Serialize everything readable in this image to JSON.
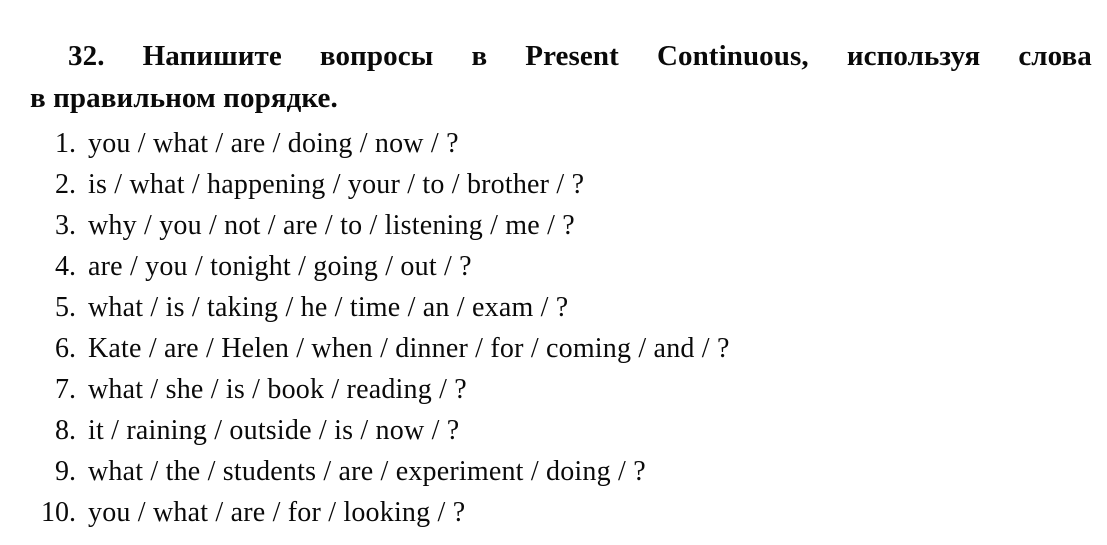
{
  "document": {
    "type": "worksheet-exercise",
    "language_mix": "russian-instruction-english-items",
    "background_color": "#ffffff",
    "text_color": "#0a0a0a"
  },
  "heading": {
    "number": "32.",
    "line_1_words": [
      "32.",
      "Напишите",
      "вопросы",
      "в",
      "Present",
      "Continuous,",
      "используя",
      "слова"
    ],
    "line_2": "в правильном порядке.",
    "full_text": "32. Напишите вопросы в Present Continuous, используя слова в правильном порядке."
  },
  "task_list": {
    "items": [
      {
        "number": "1.",
        "text": "you / what / are / doing / now / ?"
      },
      {
        "number": "2.",
        "text": "is / what / happening / your / to / brother / ?"
      },
      {
        "number": "3.",
        "text": "why / you / not / are / to / listening / me / ?"
      },
      {
        "number": "4.",
        "text": "are / you / tonight / going / out / ?"
      },
      {
        "number": "5.",
        "text": "what / is / taking / he / time / an / exam / ?"
      },
      {
        "number": "6.",
        "text": "Kate / are / Helen / when / dinner / for / coming / and / ?"
      },
      {
        "number": "7.",
        "text": "what / she / is / book / reading / ?"
      },
      {
        "number": "8.",
        "text": "it / raining / outside / is / now / ?"
      },
      {
        "number": "9.",
        "text": "what / the / students / are / experiment / doing / ?"
      },
      {
        "number": "10.",
        "text": "you / what / are / for / looking / ?"
      }
    ]
  }
}
